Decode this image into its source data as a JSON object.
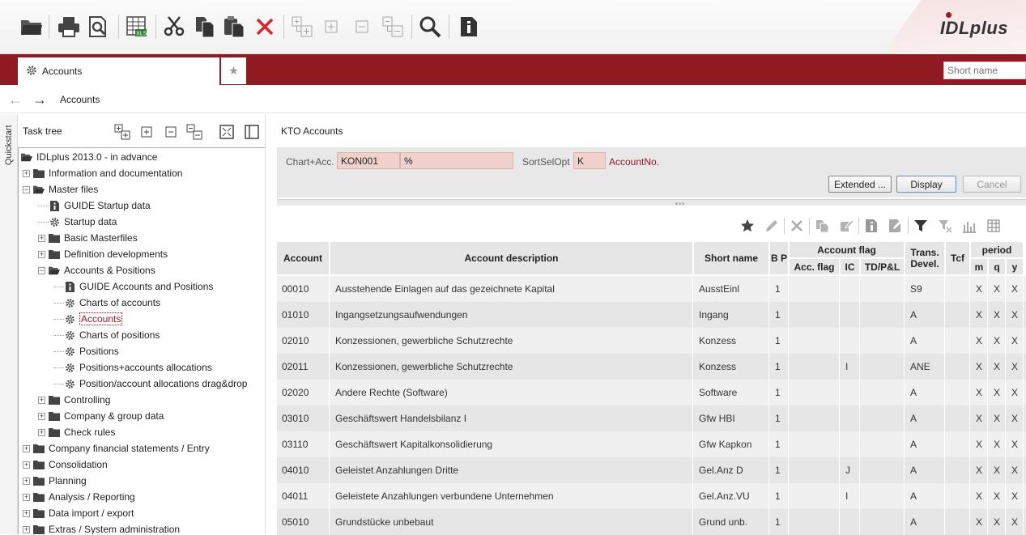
{
  "app": {
    "logo": "IDLplus",
    "tab_label": "Accounts",
    "short_name_placeholder": "Short name",
    "breadcrumb": "Accounts",
    "quickstart_label": "Quickstart"
  },
  "tasktree": {
    "title": "Task tree",
    "items": [
      {
        "label": "IDLplus 2013.0 - in advance",
        "level": 0,
        "expander": "",
        "icon": "folder-open"
      },
      {
        "label": "Information and documentation",
        "level": 1,
        "expander": "+",
        "icon": "folder"
      },
      {
        "label": "Master files",
        "level": 1,
        "expander": "-",
        "icon": "folder-open"
      },
      {
        "label": "GUIDE Startup data",
        "level": 2,
        "expander": "",
        "icon": "info"
      },
      {
        "label": "Startup data",
        "level": 2,
        "expander": "",
        "icon": "gear"
      },
      {
        "label": "Basic Masterfiles",
        "level": 2,
        "expander": "+",
        "icon": "folder"
      },
      {
        "label": "Definition developments",
        "level": 2,
        "expander": "+",
        "icon": "folder"
      },
      {
        "label": "Accounts & Positions",
        "level": 2,
        "expander": "-",
        "icon": "folder-open"
      },
      {
        "label": "GUIDE Accounts and Positions",
        "level": 3,
        "expander": "",
        "icon": "info"
      },
      {
        "label": "Charts of accounts",
        "level": 3,
        "expander": "",
        "icon": "gear"
      },
      {
        "label": "Accounts",
        "level": 3,
        "expander": "",
        "icon": "gear",
        "selected": true
      },
      {
        "label": "Charts of positions",
        "level": 3,
        "expander": "",
        "icon": "gear"
      },
      {
        "label": "Positions",
        "level": 3,
        "expander": "",
        "icon": "gear"
      },
      {
        "label": "Positions+accounts allocations",
        "level": 3,
        "expander": "",
        "icon": "gear"
      },
      {
        "label": "Position/account allocations drag&drop",
        "level": 3,
        "expander": "",
        "icon": "gear"
      },
      {
        "label": "Controlling",
        "level": 2,
        "expander": "+",
        "icon": "folder"
      },
      {
        "label": "Company & group data",
        "level": 2,
        "expander": "+",
        "icon": "folder"
      },
      {
        "label": "Check rules",
        "level": 2,
        "expander": "+",
        "icon": "folder"
      },
      {
        "label": "Company financial statements / Entry",
        "level": 1,
        "expander": "+",
        "icon": "folder"
      },
      {
        "label": "Consolidation",
        "level": 1,
        "expander": "+",
        "icon": "folder"
      },
      {
        "label": "Planning",
        "level": 1,
        "expander": "+",
        "icon": "folder"
      },
      {
        "label": "Analysis / Reporting",
        "level": 1,
        "expander": "+",
        "icon": "folder"
      },
      {
        "label": "Data import / export",
        "level": 1,
        "expander": "+",
        "icon": "folder"
      },
      {
        "label": "Extras / System administration",
        "level": 1,
        "expander": "+",
        "icon": "folder"
      }
    ]
  },
  "main": {
    "title": "KTO Accounts",
    "filter": {
      "chart_acc_label": "Chart+Acc.",
      "chart_value": "KON001",
      "acc_value": "%",
      "sortsel_label": "SortSelOpt",
      "sortsel_value": "K",
      "sortsel_desc": "AccountNo.",
      "btn_extended": "Extended ...",
      "btn_display": "Display",
      "btn_cancel": "Cancel"
    },
    "columns": {
      "account": "Account",
      "description": "Account description",
      "short_name": "Short name",
      "bp": "B P",
      "account_flag": "Account flag",
      "acc_flag": "Acc. flag",
      "ic": "IC",
      "tdpl": "TD/P&L",
      "trans_devel": "Trans. Devel.",
      "tcf": "Tcf",
      "period": "period",
      "m": "m",
      "q": "q",
      "y": "y"
    },
    "rows": [
      {
        "account": "00010",
        "description": "Ausstehende Einlagen auf das gezeichnete Kapital",
        "short_name": "AusstEinl",
        "bp": "1",
        "acc_flag": "",
        "ic": "",
        "tdpl": "",
        "trans": "S9",
        "tcf": "",
        "m": "X",
        "q": "X",
        "y": "X"
      },
      {
        "account": "01010",
        "description": "Ingangsetzungsaufwendungen",
        "short_name": "Ingang",
        "bp": "1",
        "acc_flag": "",
        "ic": "",
        "tdpl": "",
        "trans": "A",
        "tcf": "",
        "m": "X",
        "q": "X",
        "y": "X"
      },
      {
        "account": "02010",
        "description": "Konzessionen, gewerbliche Schutzrechte",
        "short_name": "Konzess",
        "bp": "1",
        "acc_flag": "",
        "ic": "",
        "tdpl": "",
        "trans": "A",
        "tcf": "",
        "m": "X",
        "q": "X",
        "y": "X"
      },
      {
        "account": "02011",
        "description": "Konzessionen, gewerbliche Schutzrechte",
        "short_name": "Konzess",
        "bp": "1",
        "acc_flag": "",
        "ic": "I",
        "tdpl": "",
        "trans": "ANE",
        "tcf": "",
        "m": "X",
        "q": "X",
        "y": "X"
      },
      {
        "account": "02020",
        "description": "Andere Rechte (Software)",
        "short_name": "Software",
        "bp": "1",
        "acc_flag": "",
        "ic": "",
        "tdpl": "",
        "trans": "A",
        "tcf": "",
        "m": "X",
        "q": "X",
        "y": "X"
      },
      {
        "account": "03010",
        "description": "Geschäftswert Handelsbilanz I",
        "short_name": "Gfw HBI",
        "bp": "1",
        "acc_flag": "",
        "ic": "",
        "tdpl": "",
        "trans": "A",
        "tcf": "",
        "m": "X",
        "q": "X",
        "y": "X"
      },
      {
        "account": "03110",
        "description": "Geschäftswert Kapitalkonsolidierung",
        "short_name": "Gfw Kapkon",
        "bp": "1",
        "acc_flag": "",
        "ic": "",
        "tdpl": "",
        "trans": "A",
        "tcf": "",
        "m": "X",
        "q": "X",
        "y": "X"
      },
      {
        "account": "04010",
        "description": "Geleistet Anzahlungen Dritte",
        "short_name": "Gel.Anz D",
        "bp": "1",
        "acc_flag": "",
        "ic": "J",
        "tdpl": "",
        "trans": "A",
        "tcf": "",
        "m": "X",
        "q": "X",
        "y": "X"
      },
      {
        "account": "04011",
        "description": "Geleistete Anzahlungen verbundene Unternehmen",
        "short_name": "Gel.Anz.VU",
        "bp": "1",
        "acc_flag": "",
        "ic": "I",
        "tdpl": "",
        "trans": "A",
        "tcf": "",
        "m": "X",
        "q": "X",
        "y": "X"
      },
      {
        "account": "05010",
        "description": "Grundstücke unbebaut",
        "short_name": "Grund unb.",
        "bp": "1",
        "acc_flag": "",
        "ic": "",
        "tdpl": "",
        "trans": "A",
        "tcf": "",
        "m": "X",
        "q": "X",
        "y": "X"
      }
    ]
  },
  "colors": {
    "brand_red": "#8f1a21",
    "filter_field_bg": "#f2d1cd"
  }
}
